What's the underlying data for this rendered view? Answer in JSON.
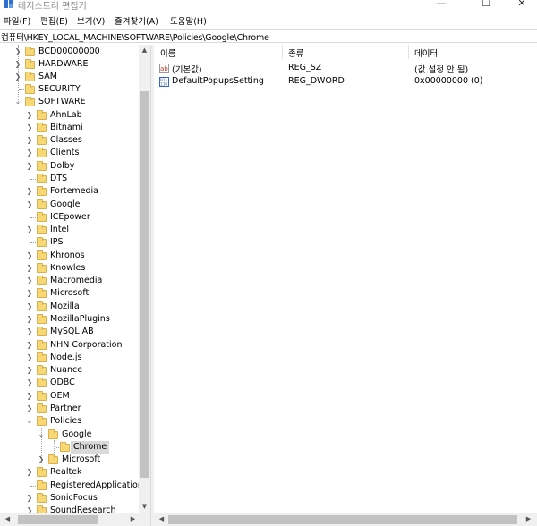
{
  "window": {
    "title": "레지스트리 편집기",
    "minimize_icon": "minimize-icon",
    "maximize_icon": "maximize-icon",
    "close_icon": "close-icon"
  },
  "menu": [
    {
      "label": "파일(F)"
    },
    {
      "label": "편집(E)"
    },
    {
      "label": "보기(V)"
    },
    {
      "label": "즐겨찾기(A)"
    },
    {
      "label": "도움말(H)"
    }
  ],
  "address": "컴퓨터\\HKEY_LOCAL_MACHINE\\SOFTWARE\\Policies\\Google\\Chrome",
  "tree": [
    {
      "label": "BCD00000000"
    },
    {
      "label": "HARDWARE"
    },
    {
      "label": "SAM"
    },
    {
      "label": "SECURITY"
    },
    {
      "label": "SOFTWARE"
    },
    {
      "label": "AhnLab"
    },
    {
      "label": "Bitnami"
    },
    {
      "label": "Classes"
    },
    {
      "label": "Clients"
    },
    {
      "label": "Dolby"
    },
    {
      "label": "DTS"
    },
    {
      "label": "Fortemedia"
    },
    {
      "label": "Google"
    },
    {
      "label": "ICEpower"
    },
    {
      "label": "Intel"
    },
    {
      "label": "IPS"
    },
    {
      "label": "Khronos"
    },
    {
      "label": "Knowles"
    },
    {
      "label": "Macromedia"
    },
    {
      "label": "Microsoft"
    },
    {
      "label": "Mozilla"
    },
    {
      "label": "MozillaPlugins"
    },
    {
      "label": "MySQL AB"
    },
    {
      "label": "NHN Corporation"
    },
    {
      "label": "Node.js"
    },
    {
      "label": "Nuance"
    },
    {
      "label": "ODBC"
    },
    {
      "label": "OEM"
    },
    {
      "label": "Partner"
    },
    {
      "label": "Policies"
    },
    {
      "label": "Google"
    },
    {
      "label": "Chrome"
    },
    {
      "label": "Microsoft"
    },
    {
      "label": "Realtek"
    },
    {
      "label": "RegisteredApplications"
    },
    {
      "label": "SonicFocus"
    },
    {
      "label": "SoundResearch"
    }
  ],
  "columns": {
    "name": "이름",
    "type": "종류",
    "data": "데이터"
  },
  "values": [
    {
      "name": "(기본값)",
      "type": "REG_SZ",
      "data": "(값 설정 안 됨)",
      "icon": "string-value-icon"
    },
    {
      "name": "DefaultPopupsSetting",
      "type": "REG_DWORD",
      "data": "0x00000000 (0)",
      "icon": "binary-value-icon"
    }
  ],
  "colors": {
    "folder": "#f8d775",
    "selection": "#d9d9d9",
    "scrollbar": "#c2c2c2"
  }
}
